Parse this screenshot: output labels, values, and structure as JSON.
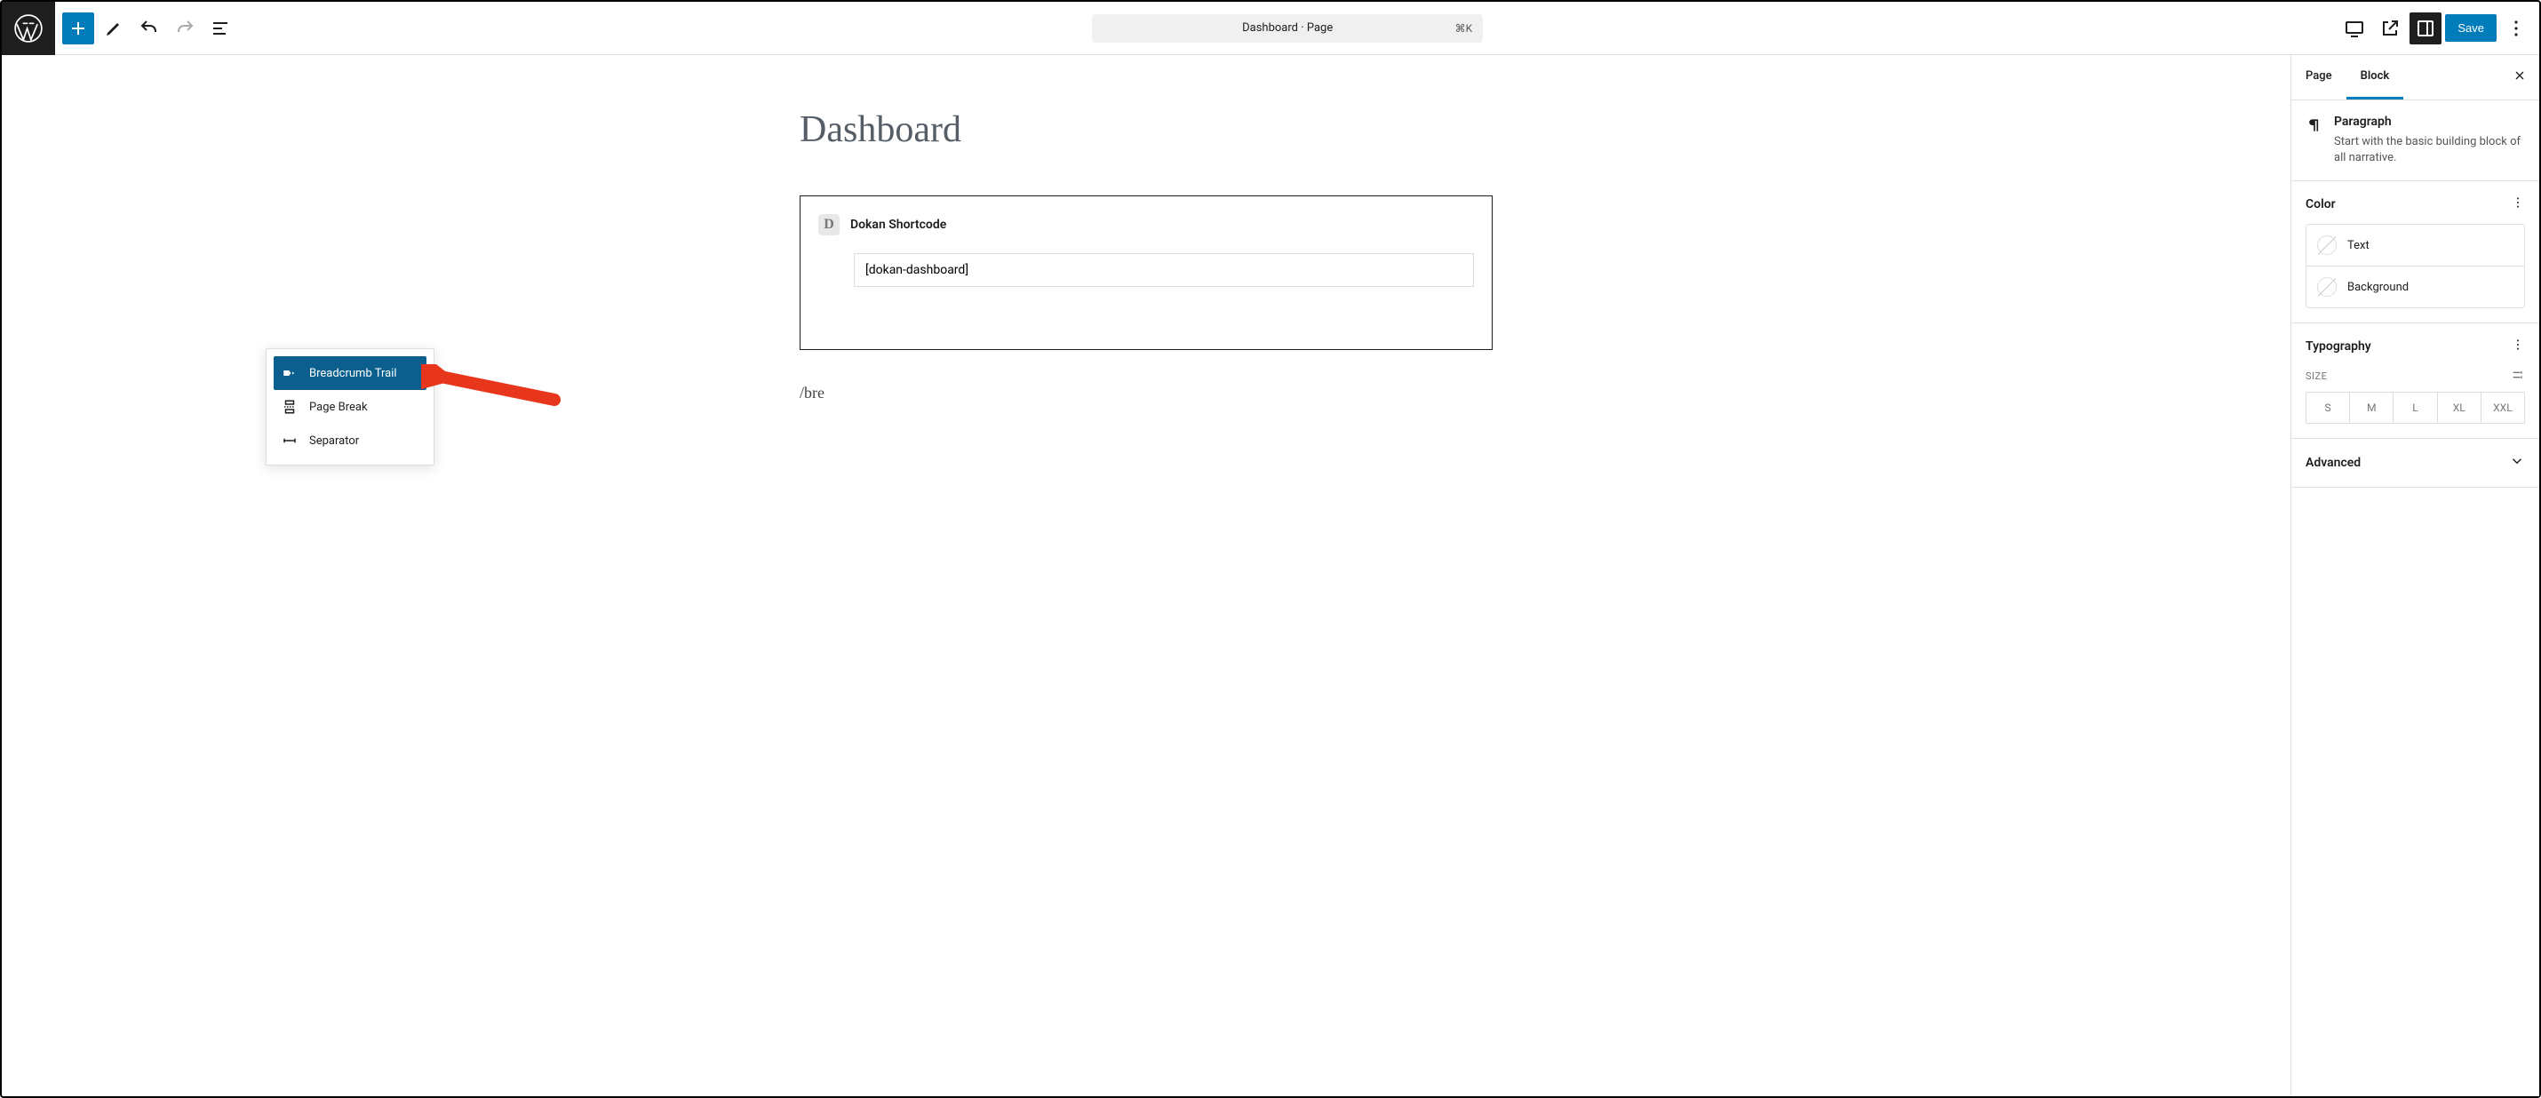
{
  "topbar": {
    "doc_title": "Dashboard · Page",
    "kbd": "⌘K",
    "save_label": "Save"
  },
  "content": {
    "page_title": "Dashboard",
    "block_label": "Dokan Shortcode",
    "shortcode_value": "[dokan-dashboard]",
    "slash_text": "/bre"
  },
  "popover": {
    "items": [
      {
        "label": "Breadcrumb Trail",
        "selected": true
      },
      {
        "label": "Page Break",
        "selected": false
      },
      {
        "label": "Separator",
        "selected": false
      }
    ]
  },
  "sidebar": {
    "tabs": {
      "page": "Page",
      "block": "Block"
    },
    "block_info": {
      "title": "Paragraph",
      "desc": "Start with the basic building block of all narrative."
    },
    "panels": {
      "color": {
        "title": "Color",
        "rows": [
          "Text",
          "Background"
        ]
      },
      "typography": {
        "title": "Typography",
        "size_label": "SIZE",
        "sizes": [
          "S",
          "M",
          "L",
          "XL",
          "XXL"
        ]
      },
      "advanced": {
        "title": "Advanced"
      }
    }
  }
}
